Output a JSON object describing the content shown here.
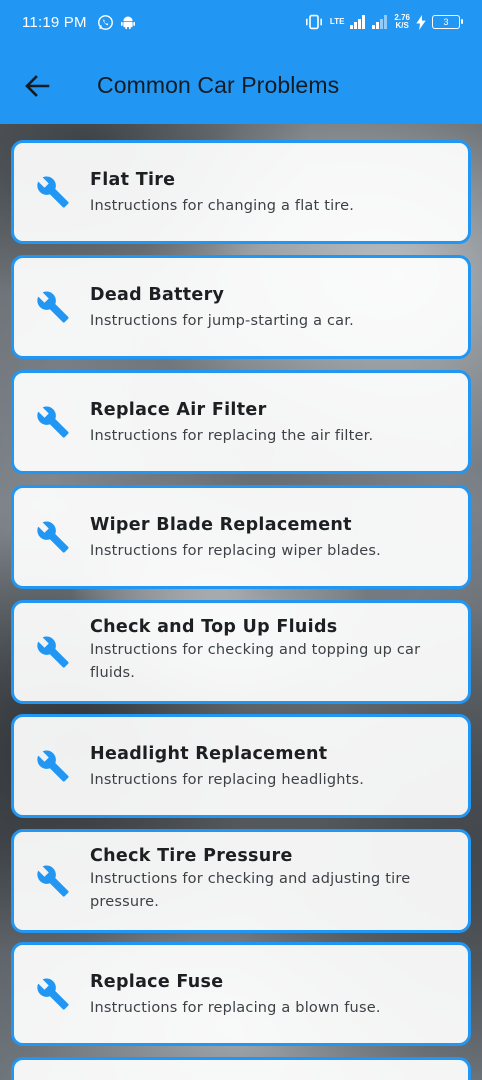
{
  "status_bar": {
    "time": "11:19 PM",
    "network_type": "LTE",
    "speed_value": "2.76",
    "speed_unit": "K/S",
    "battery_level": "3"
  },
  "app_bar": {
    "title": "Common Car Problems",
    "back_icon": "arrow-left-icon"
  },
  "items_icon": "wrench-icon",
  "accent_color": "#2196f3",
  "items": [
    {
      "title": "Flat Tire",
      "description": "Instructions for changing a flat tire."
    },
    {
      "title": "Dead Battery",
      "description": "Instructions for jump-starting a car."
    },
    {
      "title": "Replace Air Filter",
      "description": "Instructions for replacing the air filter."
    },
    {
      "title": "Wiper Blade Replacement",
      "description": "Instructions for replacing wiper blades."
    },
    {
      "title": "Check and Top Up Fluids",
      "description": "Instructions for checking and topping up car fluids."
    },
    {
      "title": "Headlight Replacement",
      "description": "Instructions for replacing headlights."
    },
    {
      "title": "Check Tire Pressure",
      "description": "Instructions for checking and adjusting tire pressure."
    },
    {
      "title": "Replace Fuse",
      "description": "Instructions for replacing a blown fuse."
    }
  ]
}
